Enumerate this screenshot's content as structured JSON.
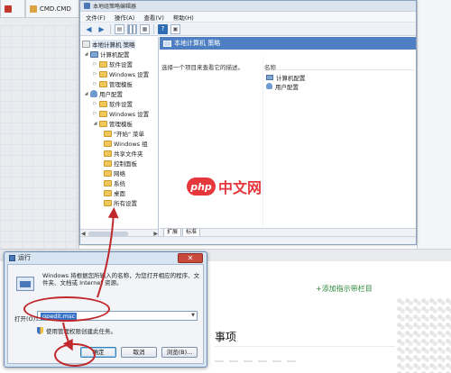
{
  "background": {
    "tabs": [
      {
        "label": ""
      },
      {
        "label": "CMD.CMD"
      }
    ]
  },
  "gpe": {
    "title": "本地组策略编辑器",
    "menu": [
      "文件(F)",
      "操作(A)",
      "查看(V)",
      "帮助(H)"
    ],
    "tree": [
      {
        "label": "本地计算机 策略",
        "icon": "policy-icon",
        "indent": 0
      },
      {
        "label": "计算机配置",
        "icon": "computer-icon",
        "indent": 1
      },
      {
        "label": "软件设置",
        "icon": "folder-icon",
        "indent": 2
      },
      {
        "label": "Windows 设置",
        "icon": "folder-icon",
        "indent": 2
      },
      {
        "label": "管理模板",
        "icon": "folder-icon",
        "indent": 2
      },
      {
        "label": "用户配置",
        "icon": "user-icon",
        "indent": 1
      },
      {
        "label": "软件设置",
        "icon": "folder-icon",
        "indent": 2
      },
      {
        "label": "Windows 设置",
        "icon": "folder-icon",
        "indent": 2
      },
      {
        "label": "管理模板",
        "icon": "folder-icon",
        "indent": 2
      },
      {
        "label": "\"开始\" 菜单",
        "icon": "folder-icon",
        "indent": 3
      },
      {
        "label": "Windows 组",
        "icon": "folder-icon",
        "indent": 3
      },
      {
        "label": "共享文件夹",
        "icon": "folder-icon",
        "indent": 3
      },
      {
        "label": "控制面板",
        "icon": "folder-icon",
        "indent": 3
      },
      {
        "label": "网络",
        "icon": "folder-icon",
        "indent": 3
      },
      {
        "label": "系统",
        "icon": "folder-icon",
        "indent": 3
      },
      {
        "label": "桌面",
        "icon": "folder-icon",
        "indent": 3
      },
      {
        "label": "所有设置",
        "icon": "folder-icon",
        "indent": 3
      }
    ],
    "detail_header": "本地计算机 策略",
    "detail_desc": "选择一个项目来查看它的描述。",
    "column_name": "名称",
    "items": [
      {
        "label": "计算机配置",
        "icon": "computer-icon"
      },
      {
        "label": "用户配置",
        "icon": "user-icon"
      }
    ],
    "tabs": [
      "扩展",
      "标准"
    ]
  },
  "watermark": {
    "logo": "php",
    "text": "中文网"
  },
  "page": {
    "link": "+添加指示带栏目",
    "heading": "事项"
  },
  "run": {
    "title": "运行",
    "close_symbol": "✕",
    "description": "Windows 将根据您所输入的名称，为您打开相应的程序、文件夹、文档或 Internet 资源。",
    "open_label": "打开(O):",
    "open_value": "gpedit.msc",
    "admin_note": "使用管理权限创建此任务。",
    "buttons": {
      "ok": "确定",
      "cancel": "取消",
      "browse": "浏览(B)..."
    }
  },
  "annotation_color": "#c0282b"
}
